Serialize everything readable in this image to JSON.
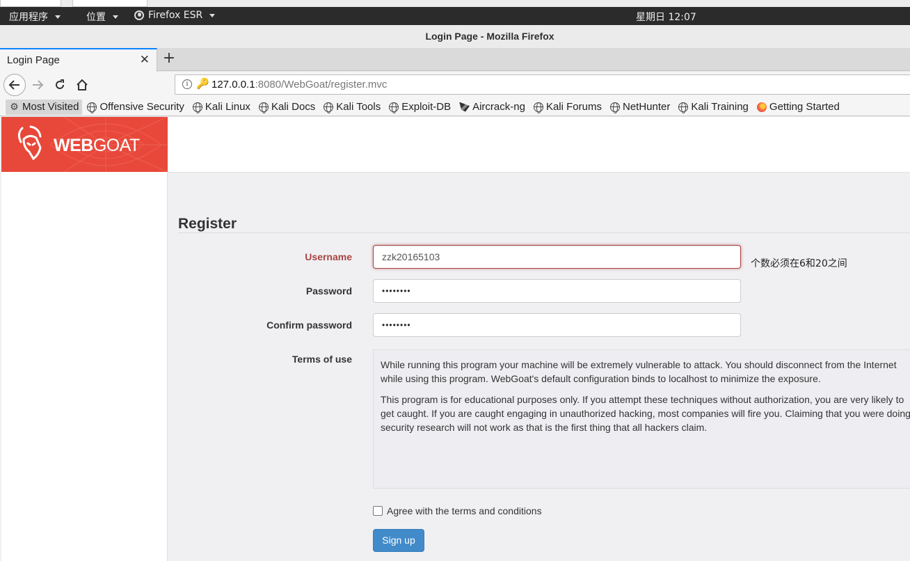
{
  "system_bar": {
    "applications_menu": "应用程序",
    "places_menu": "位置",
    "firefox_menu": "Firefox ESR",
    "clock": "星期日 12:07"
  },
  "window": {
    "title": "Login Page - Mozilla Firefox"
  },
  "tabs": [
    {
      "label": "Login Page",
      "active": true
    }
  ],
  "address_bar": {
    "url_host": "127.0.0.1",
    "url_rest": ":8080/WebGoat/register.mvc"
  },
  "bookmarks": [
    {
      "label": "Most Visited",
      "icon": "gear-icon"
    },
    {
      "label": "Offensive Security",
      "icon": "globe-icon"
    },
    {
      "label": "Kali Linux",
      "icon": "globe-icon"
    },
    {
      "label": "Kali Docs",
      "icon": "globe-icon"
    },
    {
      "label": "Kali Tools",
      "icon": "globe-icon"
    },
    {
      "label": "Exploit-DB",
      "icon": "globe-icon"
    },
    {
      "label": "Aircrack-ng",
      "icon": "aircrack-icon"
    },
    {
      "label": "Kali Forums",
      "icon": "globe-icon"
    },
    {
      "label": "NetHunter",
      "icon": "globe-icon"
    },
    {
      "label": "Kali Training",
      "icon": "globe-icon"
    },
    {
      "label": "Getting Started",
      "icon": "firefox-icon"
    }
  ],
  "brand": {
    "logo_bold": "WEB",
    "logo_rest": "GOAT",
    "color": "#e8483a"
  },
  "form": {
    "title": "Register",
    "username_label": "Username",
    "username_value": "zzk20165103",
    "username_help": "个数必须在6和20之间",
    "password_label": "Password",
    "password_value": "••••••••",
    "confirm_label": "Confirm password",
    "confirm_value": "••••••••",
    "terms_label": "Terms of use",
    "terms_p1": "While running this program your machine will be extremely vulnerable to attack. You should disconnect from the Internet while using this program. WebGoat's default configuration binds to localhost to minimize the exposure.",
    "terms_p2": "This program is for educational purposes only. If you attempt these techniques without authorization, you are very likely to get caught. If you are caught engaging in unauthorized hacking, most companies will fire you. Claiming that you were doing security research will not work as that is the first thing that all hackers claim.",
    "agree_label": "Agree with the terms and conditions",
    "agree_checked": false,
    "signup_label": "Sign up",
    "error_color": "#a94442",
    "button_color": "#428bca"
  }
}
